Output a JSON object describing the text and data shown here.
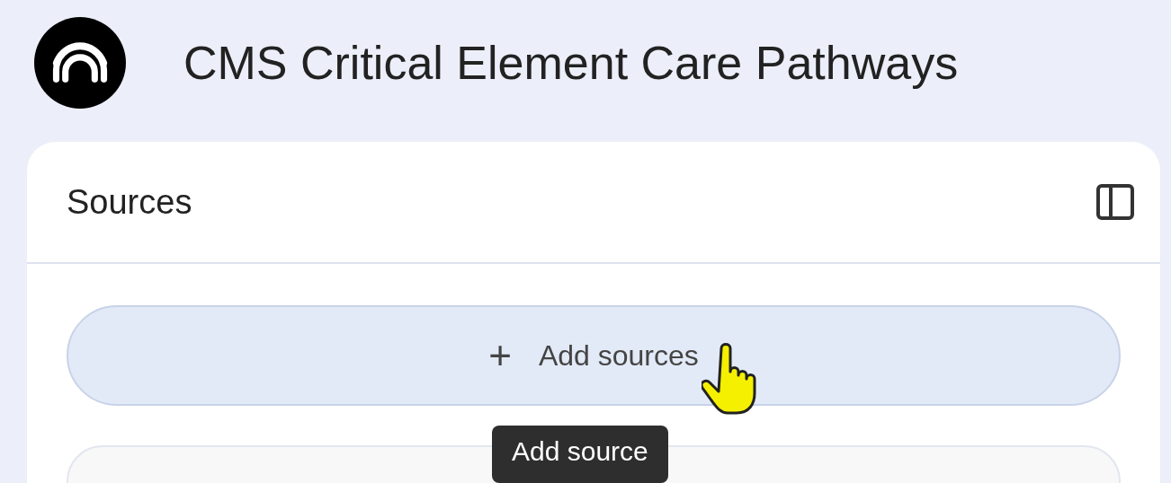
{
  "notebook": {
    "title": "CMS Critical Element Care Pathways"
  },
  "sources_panel": {
    "title": "Sources",
    "add_button": {
      "icon": "+",
      "label": "Add sources"
    },
    "tooltip": "Add source"
  }
}
